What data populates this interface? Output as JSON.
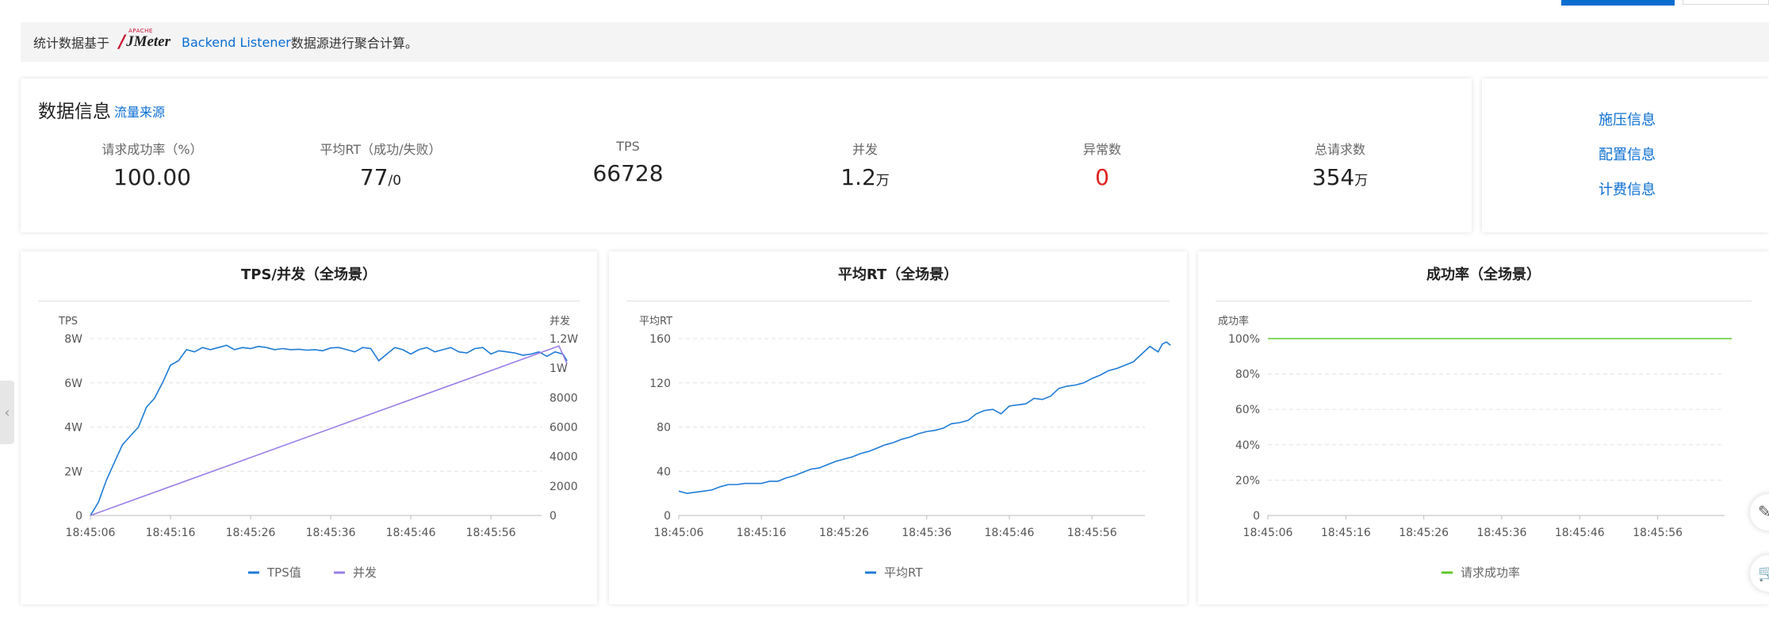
{
  "notice": {
    "prefix": "统计数据基于",
    "logo_text": "JMeter",
    "logo_apache": "APACHE",
    "link": "Backend Listener",
    "suffix": "数据源进行聚合计算。"
  },
  "info": {
    "title": "数据信息",
    "source_link": "流量来源",
    "metrics": [
      {
        "label": "请求成功率（%）",
        "value": "100.00",
        "unit": "",
        "alert": false
      },
      {
        "label": "平均RT（成功/失败）",
        "value": "77",
        "unit": "/0",
        "alert": false
      },
      {
        "label": "TPS",
        "value": "66728",
        "unit": "",
        "alert": false
      },
      {
        "label": "并发",
        "value": "1.2",
        "unit": "万",
        "alert": false
      },
      {
        "label": "异常数",
        "value": "0",
        "unit": "",
        "alert": true
      },
      {
        "label": "总请求数",
        "value": "354",
        "unit": "万",
        "alert": false
      }
    ]
  },
  "side_links": [
    "施压信息",
    "配置信息",
    "计费信息"
  ],
  "icons": {
    "side_tab": "chevron-left-icon",
    "float_1": "edit-icon",
    "float_2": "cart-icon"
  },
  "colors": {
    "primary": "#0a6ed1",
    "tps_line": "#1f7bd6",
    "concurrency_line": "#9a7ee6",
    "success_line": "#5fc92a",
    "alert": "#e02020"
  },
  "chart_data": [
    {
      "type": "line",
      "title": "TPS/并发（全场景）",
      "xlabel": "",
      "ylabel_left": "TPS",
      "ylabel_right": "并发",
      "x_ticks": [
        "18:45:06",
        "18:45:16",
        "18:45:26",
        "18:45:36",
        "18:45:46",
        "18:45:56"
      ],
      "y_left_ticks": [
        "0",
        "2W",
        "4W",
        "6W",
        "8W"
      ],
      "y_right_ticks": [
        "0",
        "2000",
        "4000",
        "6000",
        "8000",
        "1W",
        "1.2W"
      ],
      "ylim_left": [
        0,
        80000
      ],
      "ylim_right": [
        0,
        12000
      ],
      "xlim": [
        0,
        59
      ],
      "grid": true,
      "legend": "bottom",
      "series": [
        {
          "name": "TPS值",
          "axis": "left",
          "values": [
            0,
            6000,
            16000,
            24000,
            32000,
            36000,
            40000,
            49000,
            53000,
            60000,
            68000,
            70000,
            75000,
            74000,
            76000,
            75000,
            76000,
            77000,
            75000,
            76000,
            75500,
            76500,
            76000,
            75000,
            75500,
            75000,
            75200,
            74800,
            75000,
            74500,
            75800,
            76000,
            75000,
            74000,
            76000,
            75500,
            70000,
            73000,
            76000,
            75000,
            73000,
            75000,
            76000,
            74000,
            75000,
            76000,
            74000,
            73500,
            75500,
            76000,
            73000,
            74500,
            74000,
            73500,
            72500,
            73000,
            74000,
            72000,
            74000,
            73500,
            73000,
            70000
          ],
          "x": [
            0,
            1,
            2,
            3,
            4,
            5,
            6,
            7,
            8,
            9,
            10,
            11,
            12,
            13,
            14,
            15,
            16,
            17,
            18,
            19,
            20,
            21,
            22,
            23,
            24,
            25,
            26,
            27,
            28,
            29,
            30,
            31,
            32,
            33,
            34,
            35,
            36,
            37,
            38,
            39,
            40,
            41,
            42,
            43,
            44,
            45,
            46,
            47,
            48,
            49,
            50,
            51,
            52,
            53,
            54,
            55,
            56,
            57,
            58,
            58.5,
            59,
            59.5
          ]
        },
        {
          "name": "并发",
          "axis": "right",
          "x": [
            0,
            58.5,
            59.5
          ],
          "values": [
            0,
            11500,
            10300
          ]
        }
      ]
    },
    {
      "type": "line",
      "title": "平均RT（全场景）",
      "xlabel": "",
      "ylabel": "平均RT",
      "x_ticks": [
        "18:45:06",
        "18:45:16",
        "18:45:26",
        "18:45:36",
        "18:45:46",
        "18:45:56"
      ],
      "y_ticks": [
        "0",
        "40",
        "80",
        "120",
        "160"
      ],
      "ylim": [
        0,
        160
      ],
      "xlim": [
        0,
        59
      ],
      "grid": true,
      "legend": "bottom",
      "series": [
        {
          "name": "平均RT",
          "values": [
            22,
            20,
            21,
            22,
            23,
            26,
            28,
            28,
            29,
            29,
            29,
            31,
            31,
            34,
            36,
            39,
            42,
            43,
            46,
            49,
            51,
            53,
            56,
            58,
            61,
            64,
            66,
            69,
            71,
            74,
            76,
            77,
            79,
            83,
            84,
            86,
            92,
            95,
            96,
            92,
            99,
            100,
            101,
            106,
            105,
            108,
            115,
            117,
            118,
            120,
            124,
            127,
            131,
            133,
            136,
            139,
            146,
            153,
            148,
            155,
            157,
            154
          ],
          "x": [
            0,
            1,
            2,
            3,
            4,
            5,
            6,
            7,
            8,
            9,
            10,
            11,
            12,
            13,
            14,
            15,
            16,
            17,
            18,
            19,
            20,
            21,
            22,
            23,
            24,
            25,
            26,
            27,
            28,
            29,
            30,
            31,
            32,
            33,
            34,
            35,
            36,
            37,
            38,
            39,
            40,
            41,
            42,
            43,
            44,
            45,
            46,
            47,
            48,
            49,
            50,
            51,
            52,
            53,
            54,
            55,
            56,
            57,
            58,
            58.5,
            59,
            59.5
          ]
        }
      ]
    },
    {
      "type": "line",
      "title": "成功率（全场景）",
      "xlabel": "",
      "ylabel": "成功率",
      "x_ticks": [
        "18:45:06",
        "18:45:16",
        "18:45:26",
        "18:45:36",
        "18:45:46",
        "18:45:56"
      ],
      "y_ticks": [
        "0",
        "20%",
        "40%",
        "60%",
        "80%",
        "100%"
      ],
      "ylim": [
        0,
        100
      ],
      "xlim": [
        0,
        59
      ],
      "grid": true,
      "legend": "bottom",
      "series": [
        {
          "name": "请求成功率",
          "x": [
            0,
            59.5
          ],
          "values": [
            100,
            100
          ]
        }
      ]
    }
  ]
}
